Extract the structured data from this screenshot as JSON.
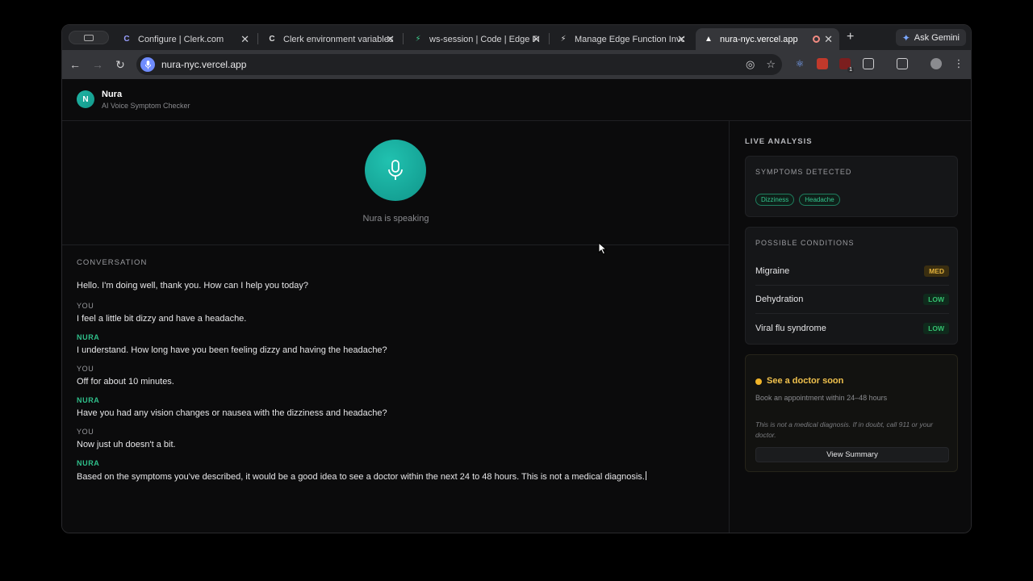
{
  "browser": {
    "tabs": [
      {
        "title": "Configure | Clerk.com",
        "favicon": "clerk-icon"
      },
      {
        "title": "Clerk environment variables",
        "favicon": "clerk-icon"
      },
      {
        "title": "ws-session | Code | Edge Fu",
        "favicon": "supabase-icon"
      },
      {
        "title": "Manage Edge Function Invo",
        "favicon": "bolt-icon"
      },
      {
        "title": "nura-nyc.vercel.app",
        "favicon": "vercel-icon"
      }
    ],
    "gemini_label": "Ask Gemini",
    "url": "nura-nyc.vercel.app",
    "extension_badge": "1"
  },
  "app": {
    "logo_letter": "N",
    "name": "Nura",
    "subtitle": "AI Voice Symptom Checker",
    "status": "Nura is speaking"
  },
  "conversation": {
    "title": "CONVERSATION",
    "messages": [
      {
        "speaker": "",
        "text": "Hello. I'm doing well, thank you. How can I help you today?"
      },
      {
        "speaker": "YOU",
        "text": "I feel a little bit dizzy and have a headache."
      },
      {
        "speaker": "NURA",
        "text": "I understand. How long have you been feeling dizzy and having the headache?"
      },
      {
        "speaker": "YOU",
        "text": "Off for about 10 minutes."
      },
      {
        "speaker": "NURA",
        "text": "Have you had any vision changes or nausea with the dizziness and headache?"
      },
      {
        "speaker": "YOU",
        "text": "Now just uh doesn't a bit."
      },
      {
        "speaker": "NURA",
        "text": "Based on the symptoms you've described, it would be a good idea to see a doctor within the next 24 to 48 hours. This is not a medical diagnosis."
      }
    ]
  },
  "analysis": {
    "title": "LIVE ANALYSIS",
    "symptoms_title": "SYMPTOMS DETECTED",
    "symptoms": [
      "Dizziness",
      "Headache"
    ],
    "conditions_title": "POSSIBLE CONDITIONS",
    "conditions": [
      {
        "name": "Migraine",
        "level": "MED"
      },
      {
        "name": "Dehydration",
        "level": "LOW"
      },
      {
        "name": "Viral flu syndrome",
        "level": "LOW"
      }
    ],
    "advice_title": "See a doctor soon",
    "advice_sub": "Book an appointment within 24–48 hours",
    "disclaimer": "This is not a medical diagnosis. If in doubt, call 911 or your doctor.",
    "summary_button": "View Summary"
  },
  "colors": {
    "accent_teal": "#1fb3a3",
    "nura_green": "#2fbf8a",
    "med_badge": "#e3b23c",
    "low_badge": "#35c06f",
    "advice_amber": "#f0b429"
  }
}
